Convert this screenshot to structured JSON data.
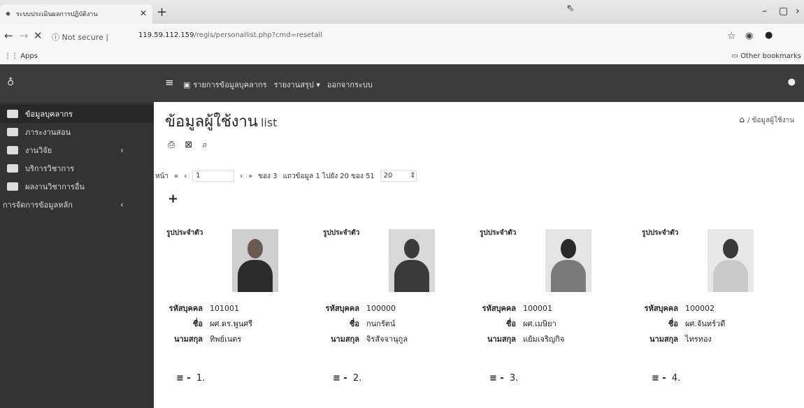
{
  "browser": {
    "tab_title": "ระบบประเมินผลการปฏิบัติงาน",
    "not_secure": "Not secure",
    "url_host": "119.59.112.159",
    "url_path": "/regis/personallist.php?cmd=resetall",
    "apps_label": "Apps",
    "other_bookmarks": "Other bookmarks"
  },
  "topbar": {
    "nav": [
      {
        "label": "รายการข้อมูลบุคลากร"
      },
      {
        "label": "รายงานสรุป ▾"
      },
      {
        "label": "ออกจากระบบ"
      }
    ]
  },
  "sidebar": {
    "items": [
      {
        "label": "ข้อมูลบุคลากร"
      },
      {
        "label": "ภาระงานสอน"
      },
      {
        "label": "งานวิจัย"
      },
      {
        "label": "บริการวิชาการ"
      },
      {
        "label": "ผลงานวิชาการอื่น"
      },
      {
        "label": "การจัดการข้อมูลหลัก"
      }
    ]
  },
  "page": {
    "title": "ข้อมูลผู้ใช้งาน",
    "title_suffix": "list",
    "breadcrumb": "ข้อมูลผู้ใช้งาน"
  },
  "pager": {
    "page_label": "หน้า",
    "page_value": "1",
    "of_total": "ของ 3",
    "records": "แถวข้อมูล 1 ไปยัง 20 ของ 51",
    "per_page": "20"
  },
  "labels": {
    "photo": "รูปประจำตัว",
    "code": "รหัสบุคคล",
    "first_name": "ชื่อ",
    "last_name": "นามสกุล"
  },
  "cards": [
    {
      "code": "101001",
      "first_name": "ผศ.ดร.พูนศรี",
      "last_name": "ทิพย์เนตร",
      "index": "1."
    },
    {
      "code": "100000",
      "first_name": "กนกรัตน์",
      "last_name": "จิรสัจจานุกูล",
      "index": "2."
    },
    {
      "code": "100001",
      "first_name": "ผศ.เมษิยา",
      "last_name": "แย้มเจริญกิจ",
      "index": "3."
    },
    {
      "code": "100002",
      "first_name": "ผศ.จันทร์วดี",
      "last_name": "ไทรทอง",
      "index": "4."
    }
  ],
  "colors": {
    "topbar": "#3c3c3c",
    "sidebar": "#333333"
  }
}
